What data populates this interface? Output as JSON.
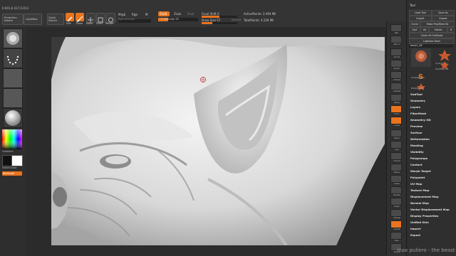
{
  "toolbar": {
    "coords": "0.601,0.427,0.013",
    "projection_master": "Projection Master",
    "lightbox": "LightBox",
    "quick_sketch": "Quick Sketch",
    "edit": "Edit",
    "draw": "Draw",
    "move": "Move",
    "scale": "Scale",
    "rotate": "Rotate",
    "mrgb": "Mrgb",
    "rgb": "Rgb",
    "m": "M",
    "rgb_intensity": "Rgb Intensity",
    "zadd": "Zadd",
    "zsub": "Zsub",
    "zcut": "Zcut",
    "z_intensity": "Z Intensity 25",
    "focal_shift": "Focal Shift 0",
    "draw_size": "Draw Size 57",
    "dynamic": "Dynamic",
    "active_points": "ActivePoints: 2.494 Mil",
    "total_points": "TotalPoints: 4.226 Mil"
  },
  "left_shelf": {
    "gradient_label": "Gradient",
    "switch_color": "SwitchColor",
    "alternate": "Alternate"
  },
  "right_shelf": {
    "items": [
      "Bpr",
      "SPix 3",
      "Scroll",
      "Zoom",
      "Actual",
      "AAHalf",
      "Persp",
      "Floor",
      "Local",
      "LSym",
      "Xyz",
      "Frame",
      "Move",
      "Scale",
      "Rotate",
      "PolyF",
      "Transp",
      "Ghost",
      "Solo",
      "Xpose"
    ]
  },
  "tool_panel": {
    "title": "Tool",
    "load_tool": "Load Tool",
    "save_as": "Save As",
    "import": "Import",
    "export": "Export",
    "clone": "Clone",
    "make_polymesh3d": "Make PolyMesh3D",
    "goz": "GoZ",
    "all": "All",
    "visible": "Visible",
    "r": "R",
    "clone_all_subtools": "Clone All SubTools",
    "lightbox_tools": "Lightbox Tools",
    "current_tool": "body2_48",
    "tools": [
      "body2_48",
      "Cylinder3D",
      "PolyMesh3D",
      "SimpleBrush",
      "PolyMesh3D"
    ],
    "menu": [
      "SubTool",
      "Geometry",
      "Layers",
      "FiberMesh",
      "Geometry HD",
      "Preview",
      "Surface",
      "Deformation",
      "Masking",
      "Visibility",
      "Polygroups",
      "Contact",
      "Morph Target",
      "Polypaint",
      "UV Map",
      "Texture Map",
      "Displacement Map",
      "Normal Map",
      "Vector Displacement Map",
      "Display Properties",
      "Unified Skin",
      "Import",
      "Export"
    ]
  },
  "watermark": "max puliero - the beast",
  "colors": {
    "accent": "#e8741e",
    "panel": "#2f2f2f",
    "canvas": "#c7c7c7"
  }
}
